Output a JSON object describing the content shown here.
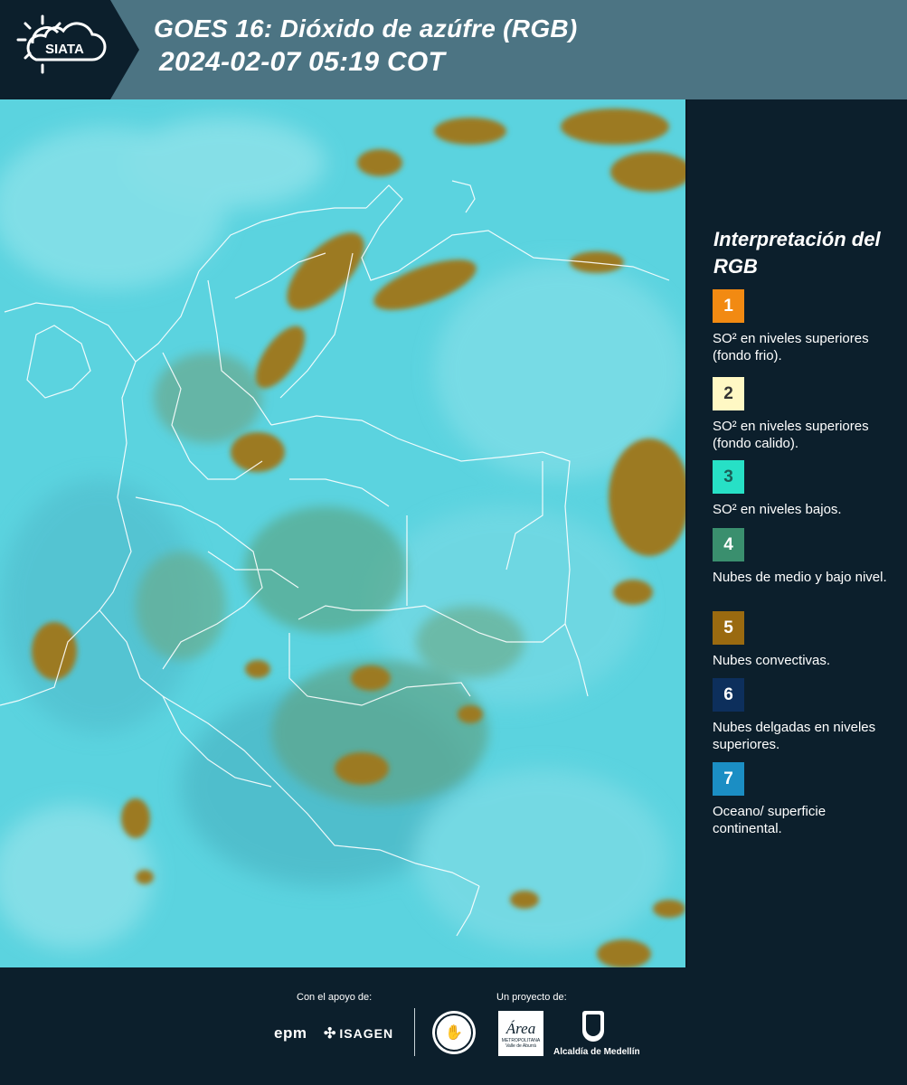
{
  "header": {
    "logo_text": "SIATA",
    "title": "GOES 16: Dióxido de azúfre (RGB)",
    "datetime": "2024-02-07 05:19 COT",
    "bg_color": "#4c7483"
  },
  "map": {
    "background_color": "#52cfdc",
    "land_cloud_color": "#9a7a1e",
    "border_color": "#ffffff"
  },
  "legend": {
    "title": "Interpretación del RGB",
    "items": [
      {
        "number": "1",
        "color": "#f28a12",
        "text": "SO² en niveles superiores (fondo frio)."
      },
      {
        "number": "2",
        "color": "#fff8c4",
        "text": "SO² en niveles superiores (fondo calido)."
      },
      {
        "number": "3",
        "color": "#27e0c6",
        "text": "SO² en niveles bajos."
      },
      {
        "number": "4",
        "color": "#3a8f6e",
        "text": "Nubes de medio y bajo nivel."
      },
      {
        "number": "5",
        "color": "#9a6a10",
        "text": "Nubes convectivas."
      },
      {
        "number": "6",
        "color": "#0d2f5c",
        "text": "Nubes delgadas en niveles superiores."
      },
      {
        "number": "7",
        "color": "#1b8ec4",
        "text": "Oceano/ superficie continental."
      }
    ]
  },
  "footer": {
    "support_label": "Con el apoyo de:",
    "project_label": "Un proyecto de:",
    "sponsors": [
      "epm",
      "ISAGEN"
    ],
    "partners": [
      "Área Metropolitana Valle de Aburrá",
      "Alcaldía de Medellín"
    ],
    "area_logo_text": "Área",
    "area_logo_sub": "METROPOLITANA Valle de Aburrá",
    "alcaldia_label": "Alcaldía de Medellín"
  }
}
